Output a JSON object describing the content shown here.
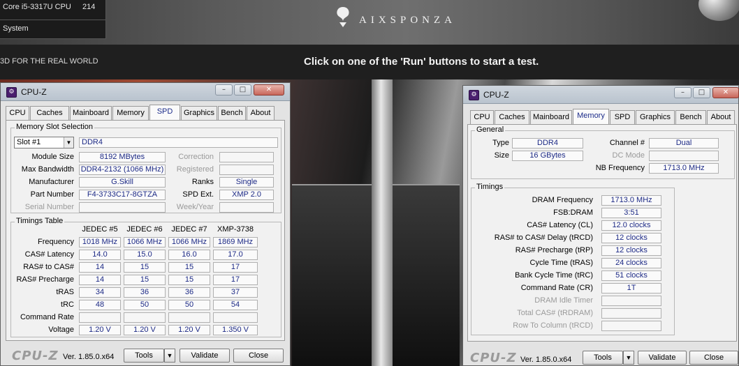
{
  "background": {
    "cpu_name": "Core i5-3317U CPU",
    "cpu_score": "214",
    "system_label": "System",
    "logo_text": "AIXSPONZA",
    "logo_mark": "®",
    "tagline": "3D FOR THE REAL WORLD",
    "instruction": "Click on one of the 'Run' buttons to start a test."
  },
  "left_window": {
    "title": "CPU-Z",
    "tabs": [
      "CPU",
      "Caches",
      "Mainboard",
      "Memory",
      "SPD",
      "Graphics",
      "Bench",
      "About"
    ],
    "active_tab": "SPD",
    "slot_group_title": "Memory Slot Selection",
    "slot_select": "Slot #1",
    "mem_type": "DDR4",
    "labels": {
      "module_size": "Module Size",
      "max_bandwidth": "Max Bandwidth",
      "manufacturer": "Manufacturer",
      "part_number": "Part Number",
      "serial_number": "Serial Number",
      "correction": "Correction",
      "registered": "Registered",
      "ranks": "Ranks",
      "spd_ext": "SPD Ext.",
      "week_year": "Week/Year"
    },
    "values": {
      "module_size": "8192 MBytes",
      "max_bandwidth": "DDR4-2132 (1066 MHz)",
      "manufacturer": "G.Skill",
      "part_number": "F4-3733C17-8GTZA",
      "ranks": "Single",
      "spd_ext": "XMP 2.0"
    },
    "timings_title": "Timings Table",
    "timings_columns": [
      "JEDEC #5",
      "JEDEC #6",
      "JEDEC #7",
      "XMP-3738"
    ],
    "timings_rows": [
      {
        "label": "Frequency",
        "values": [
          "1018 MHz",
          "1066 MHz",
          "1066 MHz",
          "1869 MHz"
        ]
      },
      {
        "label": "CAS# Latency",
        "values": [
          "14.0",
          "15.0",
          "16.0",
          "17.0"
        ]
      },
      {
        "label": "RAS# to CAS#",
        "values": [
          "14",
          "15",
          "15",
          "17"
        ]
      },
      {
        "label": "RAS# Precharge",
        "values": [
          "14",
          "15",
          "15",
          "17"
        ]
      },
      {
        "label": "tRAS",
        "values": [
          "34",
          "36",
          "36",
          "37"
        ]
      },
      {
        "label": "tRC",
        "values": [
          "48",
          "50",
          "50",
          "54"
        ]
      },
      {
        "label": "Command Rate",
        "values": [
          "",
          "",
          "",
          ""
        ]
      },
      {
        "label": "Voltage",
        "values": [
          "1.20 V",
          "1.20 V",
          "1.20 V",
          "1.350 V"
        ]
      }
    ],
    "footer": {
      "logo": "CPU-Z",
      "version": "Ver. 1.85.0.x64",
      "tools": "Tools",
      "validate": "Validate",
      "close": "Close"
    }
  },
  "right_window": {
    "title": "CPU-Z",
    "tabs": [
      "CPU",
      "Caches",
      "Mainboard",
      "Memory",
      "SPD",
      "Graphics",
      "Bench",
      "About"
    ],
    "active_tab": "Memory",
    "general_title": "General",
    "labels": {
      "type": "Type",
      "size": "Size",
      "channel": "Channel #",
      "dc_mode": "DC Mode",
      "nb_frequency": "NB Frequency"
    },
    "values": {
      "type": "DDR4",
      "size": "16 GBytes",
      "channel": "Dual",
      "nb_frequency": "1713.0 MHz"
    },
    "timings_title": "Timings",
    "timings_rows": [
      {
        "label": "DRAM Frequency",
        "value": "1713.0 MHz",
        "dim": false
      },
      {
        "label": "FSB:DRAM",
        "value": "3:51",
        "dim": false
      },
      {
        "label": "CAS# Latency (CL)",
        "value": "12.0 clocks",
        "dim": false
      },
      {
        "label": "RAS# to CAS# Delay (tRCD)",
        "value": "12 clocks",
        "dim": false
      },
      {
        "label": "RAS# Precharge (tRP)",
        "value": "12 clocks",
        "dim": false
      },
      {
        "label": "Cycle Time (tRAS)",
        "value": "24 clocks",
        "dim": false
      },
      {
        "label": "Bank Cycle Time (tRC)",
        "value": "51 clocks",
        "dim": false
      },
      {
        "label": "Command Rate (CR)",
        "value": "1T",
        "dim": false
      },
      {
        "label": "DRAM Idle Timer",
        "value": "",
        "dim": true
      },
      {
        "label": "Total CAS# (tRDRAM)",
        "value": "",
        "dim": true
      },
      {
        "label": "Row To Column (tRCD)",
        "value": "",
        "dim": true
      }
    ],
    "footer": {
      "logo": "CPU-Z",
      "version": "Ver. 1.85.0.x64",
      "tools": "Tools",
      "validate": "Validate",
      "close": "Close"
    }
  }
}
